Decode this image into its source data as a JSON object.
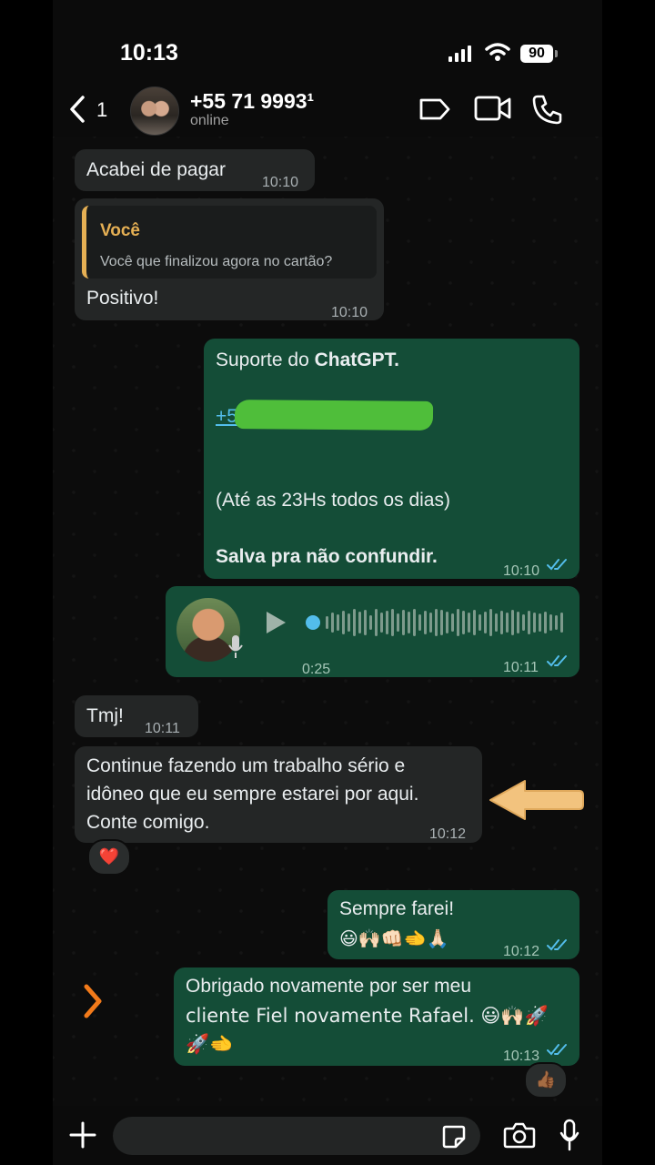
{
  "status_bar": {
    "time": "10:13",
    "battery": "90"
  },
  "header": {
    "back_count": "1",
    "contact_name": "+55 71 9993¹",
    "contact_status": "online"
  },
  "messages": {
    "m1": {
      "text": "Acabei de pagar",
      "time": "10:10"
    },
    "m2": {
      "quote_author": "Você",
      "quote_text": "Você que finalizou agora no cartão?",
      "text": "Positivo!",
      "time": "10:10"
    },
    "m3": {
      "line1_prefix": "Suporte do ",
      "line1_bold": "ChatGPT.",
      "link_prefix": "+55 8",
      "line2": "(Até as 23Hs todos os dias)",
      "line3": "Salva pra não confundir.",
      "time": "10:10"
    },
    "m4": {
      "duration": "0:25",
      "time": "10:11"
    },
    "m5": {
      "text": "Tmj!",
      "time": "10:11"
    },
    "m6": {
      "line1": "Continue fazendo um trabalho sério e",
      "line2": "idôneo que eu sempre estarei por aqui.",
      "line3": "Conte comigo.",
      "time": "10:12",
      "reaction": "❤️"
    },
    "m7": {
      "line1": "Sempre farei!",
      "line2": "😃🙌🏻👊🏻🫲🙏🏻",
      "time": "10:12"
    },
    "m8": {
      "line1": "Obrigado novamente por ser meu",
      "line2": "cliente Fiel novamente Rafael. 😃🙌🏻🚀",
      "line3": "🚀🫲",
      "time": "10:13",
      "reaction": "👍🏾"
    }
  },
  "colors": {
    "outgoing_bubble": "#144d37",
    "incoming_bubble": "#242626",
    "quote_accent": "#e6b054",
    "read_ticks": "#53bdeb"
  },
  "icons": [
    "back-chevron-icon",
    "tag-icon",
    "video-call-icon",
    "phone-icon",
    "plus-icon",
    "sticker-icon",
    "camera-icon",
    "microphone-icon",
    "play-icon",
    "pointer-arrow-icon",
    "forward-chevron-icon"
  ]
}
